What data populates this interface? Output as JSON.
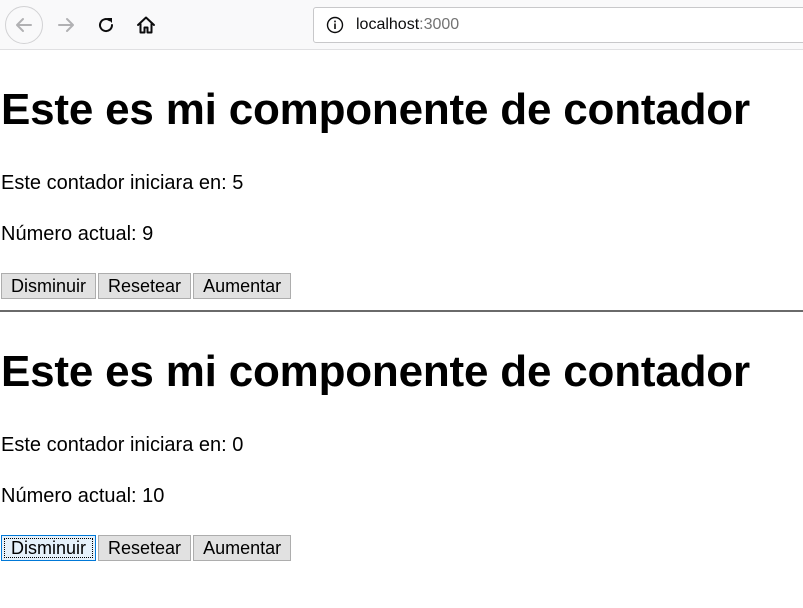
{
  "browser": {
    "url_host": "localhost",
    "url_port": ":3000",
    "icons": {
      "back": "back-arrow-icon",
      "forward": "forward-arrow-icon",
      "reload": "reload-icon",
      "home": "home-icon",
      "info": "info-icon"
    }
  },
  "counters": [
    {
      "title": "Este es mi componente de contador",
      "start_text": "Este contador iniciara en: 5",
      "current_text": "Número actual: 9",
      "decrease_label": "Disminuir",
      "reset_label": "Resetear",
      "increase_label": "Aumentar"
    },
    {
      "title": "Este es mi componente de contador",
      "start_text": "Este contador iniciara en: 0",
      "current_text": "Número actual: 10",
      "decrease_label": "Disminuir",
      "reset_label": "Resetear",
      "increase_label": "Aumentar"
    }
  ],
  "colors": {
    "toolbar_bg": "#f9f9fa",
    "button_bg": "#e1e1e1",
    "focus_border": "#0078d7",
    "divider": "#6a6a6a"
  }
}
